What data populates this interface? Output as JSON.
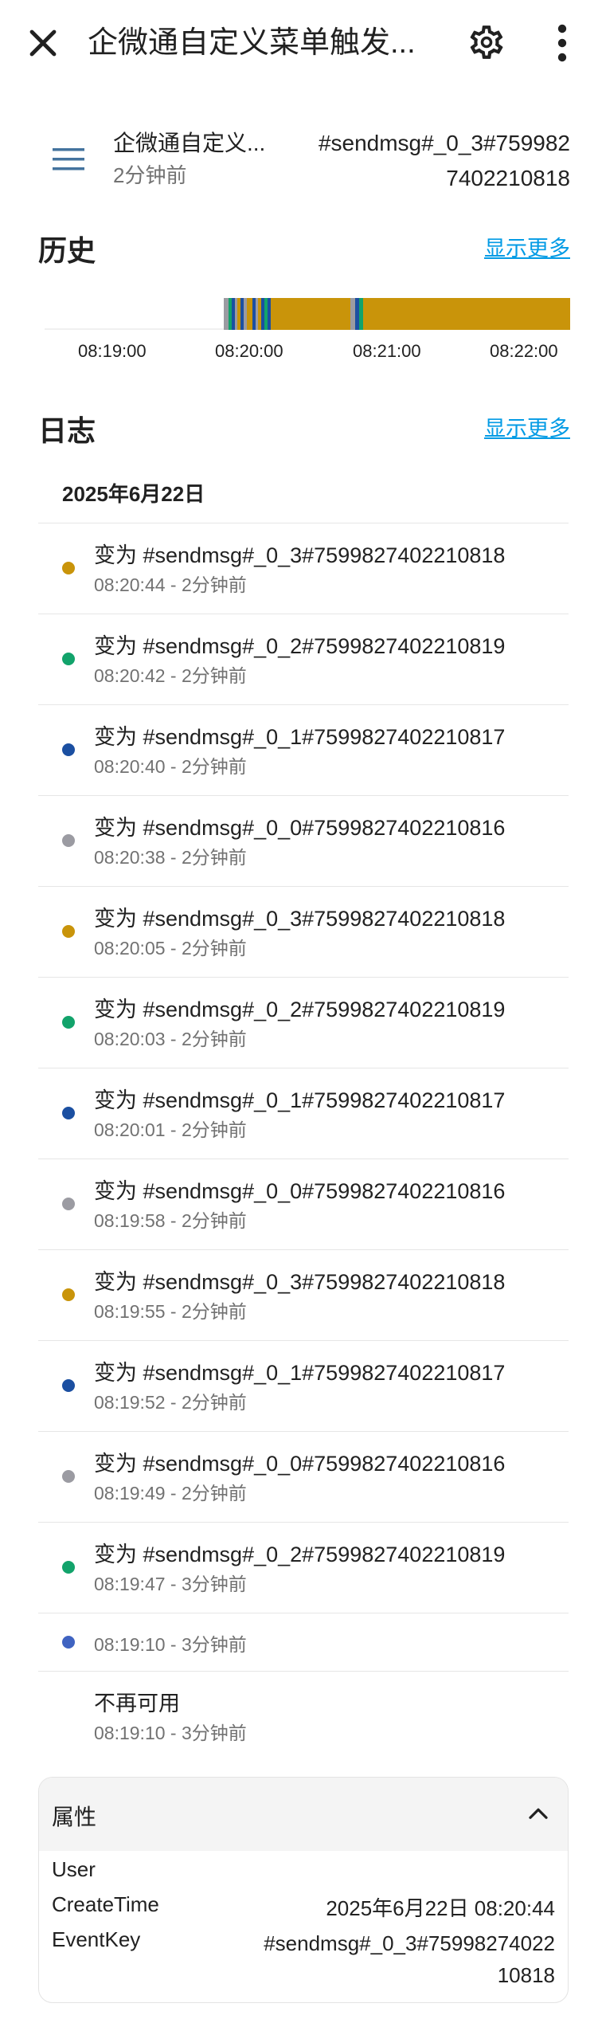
{
  "topbar": {
    "title": "企微通自定义菜单触发...",
    "icons": {
      "close": "close-icon",
      "settings": "gear-icon",
      "more": "more-vert-icon"
    }
  },
  "entity": {
    "name": "企微通自定义...",
    "ago": "2分钟前",
    "state": "#sendmsg#_0_3#7599827402210818"
  },
  "history": {
    "title": "历史",
    "show_more": "显示更多",
    "ticks": [
      "08:19:00",
      "08:20:00",
      "08:21:00",
      "08:22:00"
    ],
    "colors": {
      "gold": "#c9940a",
      "green": "#12a36b",
      "blue": "#1b4fa1",
      "gray": "#9b9ba2",
      "light_gray": "#e8e8e8"
    }
  },
  "logbook": {
    "title": "日志",
    "show_more": "显示更多",
    "date": "2025年6月22日",
    "entries": [
      {
        "message": "变为 #sendmsg#_0_3#7599827402210818",
        "time": "08:20:44 - 2分钟前",
        "color": "#c9940a"
      },
      {
        "message": "变为 #sendmsg#_0_2#7599827402210819",
        "time": "08:20:42 - 2分钟前",
        "color": "#12a36b"
      },
      {
        "message": "变为 #sendmsg#_0_1#7599827402210817",
        "time": "08:20:40 - 2分钟前",
        "color": "#1b4fa1"
      },
      {
        "message": "变为 #sendmsg#_0_0#7599827402210816",
        "time": "08:20:38 - 2分钟前",
        "color": "#9b9ba2"
      },
      {
        "message": "变为 #sendmsg#_0_3#7599827402210818",
        "time": "08:20:05 - 2分钟前",
        "color": "#c9940a"
      },
      {
        "message": "变为 #sendmsg#_0_2#7599827402210819",
        "time": "08:20:03 - 2分钟前",
        "color": "#12a36b"
      },
      {
        "message": "变为 #sendmsg#_0_1#7599827402210817",
        "time": "08:20:01 - 2分钟前",
        "color": "#1b4fa1"
      },
      {
        "message": "变为 #sendmsg#_0_0#7599827402210816",
        "time": "08:19:58 - 2分钟前",
        "color": "#9b9ba2"
      },
      {
        "message": "变为 #sendmsg#_0_3#7599827402210818",
        "time": "08:19:55 - 2分钟前",
        "color": "#c9940a"
      },
      {
        "message": "变为 #sendmsg#_0_1#7599827402210817",
        "time": "08:19:52 - 2分钟前",
        "color": "#1b4fa1"
      },
      {
        "message": "变为 #sendmsg#_0_0#7599827402210816",
        "time": "08:19:49 - 2分钟前",
        "color": "#9b9ba2"
      },
      {
        "message": "变为 #sendmsg#_0_2#7599827402210819",
        "time": "08:19:47 - 3分钟前",
        "color": "#12a36b"
      },
      {
        "message": "",
        "time": "08:19:10 - 3分钟前",
        "color": "#3f63c1"
      },
      {
        "message": "不再可用",
        "time": "08:19:10 - 3分钟前",
        "color": ""
      }
    ]
  },
  "attributes": {
    "title": "属性",
    "rows": [
      {
        "key": "User",
        "value": ""
      },
      {
        "key": "CreateTime",
        "value": "2025年6月22日 08:20:44"
      },
      {
        "key": "EventKey",
        "value": "#sendmsg#_0_3#7599827402210818"
      }
    ]
  }
}
